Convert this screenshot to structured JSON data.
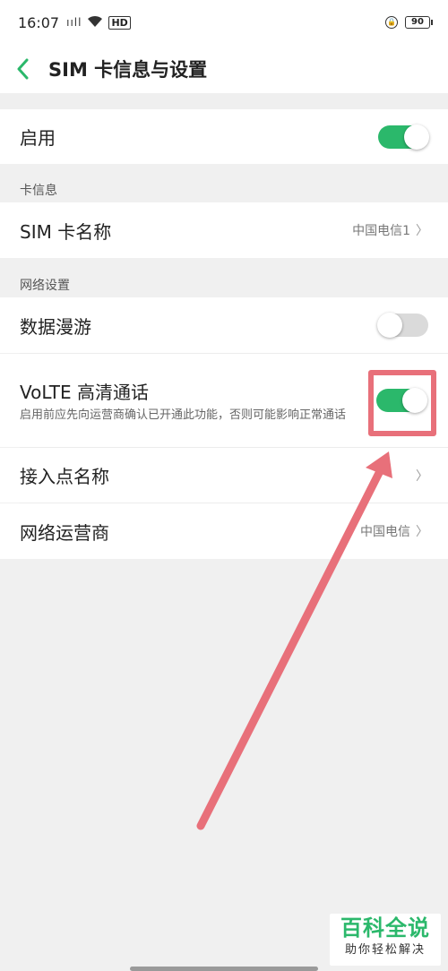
{
  "status_bar": {
    "time": "16:07",
    "signal": "ııll",
    "battery": "90"
  },
  "header": {
    "title": "SIM 卡信息与设置"
  },
  "enable": {
    "label": "启用",
    "toggle_on": true
  },
  "card_info": {
    "section_label": "卡信息",
    "sim_name_label": "SIM 卡名称",
    "sim_name_value": "中国电信1"
  },
  "network": {
    "section_label": "网络设置",
    "roaming_label": "数据漫游",
    "roaming_on": false,
    "volte_label": "VoLTE 高清通话",
    "volte_desc": "启用前应先向运营商确认已开通此功能，否则可能影响正常通话",
    "volte_on": true,
    "apn_label": "接入点名称",
    "operator_label": "网络运营商",
    "operator_value": "中国电信"
  },
  "watermark": {
    "title": "百科全说",
    "subtitle": "助你轻松解决"
  },
  "colors": {
    "accent": "#2bb86b",
    "highlight": "#e8707a"
  }
}
